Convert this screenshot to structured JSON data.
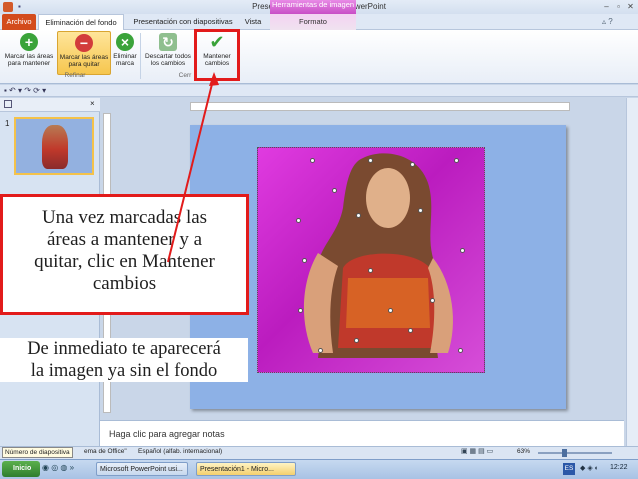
{
  "window": {
    "title": "Presentación1  -  Microsoft PowerPoint",
    "context_tab_header": "Herramientas de imagen"
  },
  "tabs": [
    {
      "label": "Archivo"
    },
    {
      "label": "Eliminación del fondo"
    },
    {
      "label": "Presentación con diapositivas"
    },
    {
      "label": "Vista"
    },
    {
      "label": "Formato"
    }
  ],
  "ribbon": {
    "buttons": [
      {
        "label": "Marcar las áreas para mantener",
        "icon": "plus-icon",
        "color": "#3aa33a"
      },
      {
        "label": "Marcar las áreas para quitar",
        "icon": "minus-icon",
        "color": "#d23b3b"
      },
      {
        "label": "Eliminar marca",
        "icon": "x-icon",
        "color": "#3aa33a"
      },
      {
        "label": "Descartar todos los cambios",
        "icon": "discard-icon",
        "color": "#6fa36f"
      },
      {
        "label": "Mantener cambios",
        "icon": "check-icon",
        "color": "#3aa33a"
      }
    ],
    "group_refinar": "Refinar",
    "group_cerrar": "Cerr"
  },
  "slide_panel": {
    "slide_number": "1"
  },
  "notes_placeholder": "Haga clic para agregar notas",
  "callouts": {
    "box_text": [
      "Una vez marcadas las",
      "áreas a mantener y a",
      "quitar, clic en Mantener",
      "cambios"
    ],
    "below_text": [
      "De inmediato te aparecerá",
      "la imagen ya sin el fondo"
    ]
  },
  "status": {
    "slide_number_label": "Número de diapositiva",
    "theme": "ema de Office\"",
    "language": "Español (alfab. internacional)",
    "zoom": "63%"
  },
  "taskbar": {
    "start": "Inicio",
    "items": [
      "Microsoft PowerPoint usi...",
      "Presentación1 - Micro..."
    ],
    "lang": "ES",
    "clock": "12:22"
  },
  "colors": {
    "accent_red": "#e21b1b",
    "magenta_bg": "#c427c8",
    "slide_bg": "#8db1e6"
  }
}
